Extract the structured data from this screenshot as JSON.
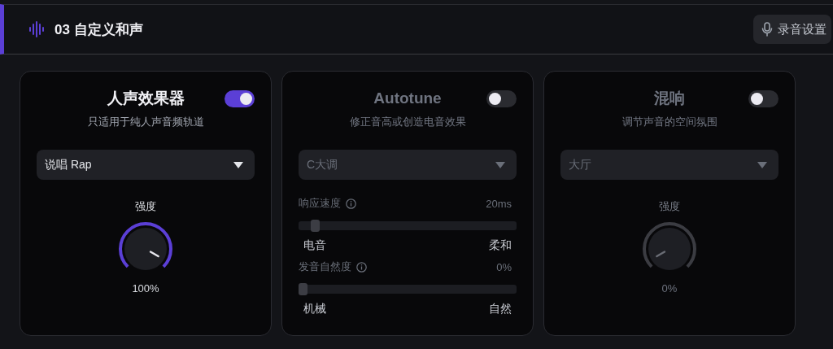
{
  "header": {
    "title": "03 自定义和声",
    "button": "录音设置"
  },
  "cards": [
    {
      "kind": "knob",
      "title": "人声效果器",
      "on": true,
      "subtitle": "只适用于纯人声音频轨道",
      "dropdown": "说唱 Rap",
      "knob": {
        "label": "强度",
        "reading": "100%"
      }
    },
    {
      "kind": "sliders",
      "title": "Autotune",
      "on": false,
      "subtitle": "修正音高或创造电音效果",
      "dropdown": "C大调",
      "sliders": [
        {
          "label": "响应速度",
          "reading": "20ms",
          "level": 0.06,
          "min_label": "电音",
          "max_label": "柔和"
        },
        {
          "label": "发音自然度",
          "reading": "0%",
          "level": 0,
          "min_label": "机械",
          "max_label": "自然"
        }
      ]
    },
    {
      "kind": "knob",
      "title": "混响",
      "on": false,
      "subtitle": "调节声音的空间氛围",
      "dropdown": "大厅",
      "knob": {
        "label": "强度",
        "reading": "0%"
      }
    }
  ]
}
